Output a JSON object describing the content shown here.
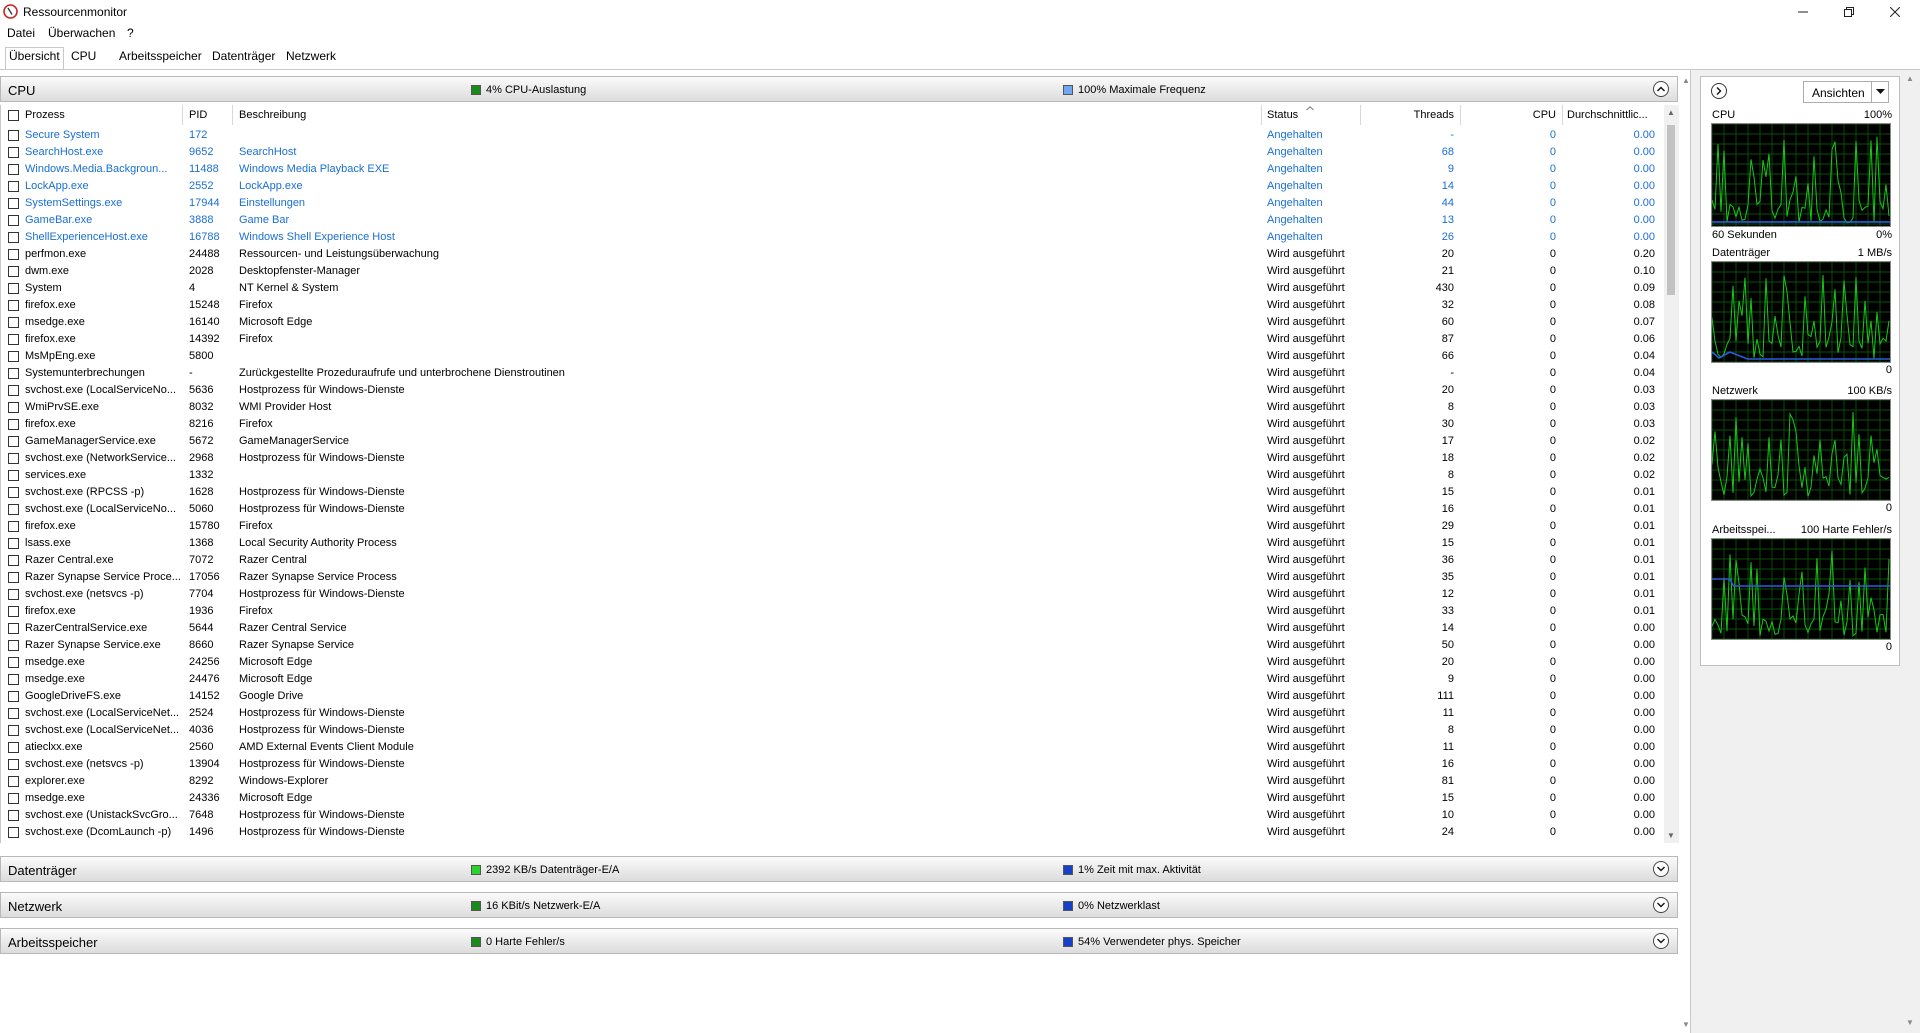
{
  "window": {
    "title": "Ressourcenmonitor"
  },
  "menu": [
    "Datei",
    "Überwachen",
    "?"
  ],
  "tabs": [
    "Übersicht",
    "CPU",
    "Arbeitsspeicher",
    "Datenträger",
    "Netzwerk"
  ],
  "sections": {
    "cpu": {
      "title": "CPU",
      "stat1": "4% CPU-Auslastung",
      "stat2": "100% Maximale Frequenz",
      "color1": "#1b8a1b",
      "color2": "#6fa8f0"
    },
    "disk": {
      "title": "Datenträger",
      "stat1": "2392 KB/s Datenträger-E/A",
      "stat2": "1% Zeit mit max. Aktivität",
      "color1": "#2ad32a",
      "color2": "#1640c8"
    },
    "network": {
      "title": "Netzwerk",
      "stat1": "16 KBit/s Netzwerk-E/A",
      "stat2": "0% Netzwerklast",
      "color1": "#1b8a1b",
      "color2": "#1640c8"
    },
    "memory": {
      "title": "Arbeitsspeicher",
      "stat1": "0 Harte Fehler/s",
      "stat2": "54% Verwendeter phys. Speicher",
      "color1": "#1b8a1b",
      "color2": "#1640c8"
    }
  },
  "columns": {
    "process": "Prozess",
    "pid": "PID",
    "description": "Beschreibung",
    "status": "Status",
    "threads": "Threads",
    "cpu": "CPU",
    "avg": "Durchschnittlic..."
  },
  "rows": [
    [
      "Secure System",
      "172",
      "",
      "Angehalten",
      "-",
      "0",
      "0.00"
    ],
    [
      "SearchHost.exe",
      "9652",
      "SearchHost",
      "Angehalten",
      "68",
      "0",
      "0.00"
    ],
    [
      "Windows.Media.Backgroun...",
      "11488",
      "Windows Media Playback EXE",
      "Angehalten",
      "9",
      "0",
      "0.00"
    ],
    [
      "LockApp.exe",
      "2552",
      "LockApp.exe",
      "Angehalten",
      "14",
      "0",
      "0.00"
    ],
    [
      "SystemSettings.exe",
      "17944",
      "Einstellungen",
      "Angehalten",
      "44",
      "0",
      "0.00"
    ],
    [
      "GameBar.exe",
      "3888",
      "Game Bar",
      "Angehalten",
      "13",
      "0",
      "0.00"
    ],
    [
      "ShellExperienceHost.exe",
      "16788",
      "Windows Shell Experience Host",
      "Angehalten",
      "26",
      "0",
      "0.00"
    ],
    [
      "perfmon.exe",
      "24488",
      "Ressourcen- und Leistungsüberwachung",
      "Wird ausgeführt",
      "20",
      "0",
      "0.20"
    ],
    [
      "dwm.exe",
      "2028",
      "Desktopfenster-Manager",
      "Wird ausgeführt",
      "21",
      "0",
      "0.10"
    ],
    [
      "System",
      "4",
      "NT Kernel & System",
      "Wird ausgeführt",
      "430",
      "0",
      "0.09"
    ],
    [
      "firefox.exe",
      "15248",
      "Firefox",
      "Wird ausgeführt",
      "32",
      "0",
      "0.08"
    ],
    [
      "msedge.exe",
      "16140",
      "Microsoft Edge",
      "Wird ausgeführt",
      "60",
      "0",
      "0.07"
    ],
    [
      "firefox.exe",
      "14392",
      "Firefox",
      "Wird ausgeführt",
      "87",
      "0",
      "0.06"
    ],
    [
      "MsMpEng.exe",
      "5800",
      "",
      "Wird ausgeführt",
      "66",
      "0",
      "0.04"
    ],
    [
      "Systemunterbrechungen",
      "-",
      "Zurückgestellte Prozeduraufrufe und unterbrochene Dienstroutinen",
      "Wird ausgeführt",
      "-",
      "0",
      "0.04"
    ],
    [
      "svchost.exe (LocalServiceNo...",
      "5636",
      "Hostprozess für Windows-Dienste",
      "Wird ausgeführt",
      "20",
      "0",
      "0.03"
    ],
    [
      "WmiPrvSE.exe",
      "8032",
      "WMI Provider Host",
      "Wird ausgeführt",
      "8",
      "0",
      "0.03"
    ],
    [
      "firefox.exe",
      "8216",
      "Firefox",
      "Wird ausgeführt",
      "30",
      "0",
      "0.03"
    ],
    [
      "GameManagerService.exe",
      "5672",
      "GameManagerService",
      "Wird ausgeführt",
      "17",
      "0",
      "0.02"
    ],
    [
      "svchost.exe (NetworkService...",
      "2968",
      "Hostprozess für Windows-Dienste",
      "Wird ausgeführt",
      "18",
      "0",
      "0.02"
    ],
    [
      "services.exe",
      "1332",
      "",
      "Wird ausgeführt",
      "8",
      "0",
      "0.02"
    ],
    [
      "svchost.exe (RPCSS -p)",
      "1628",
      "Hostprozess für Windows-Dienste",
      "Wird ausgeführt",
      "15",
      "0",
      "0.01"
    ],
    [
      "svchost.exe (LocalServiceNo...",
      "5060",
      "Hostprozess für Windows-Dienste",
      "Wird ausgeführt",
      "16",
      "0",
      "0.01"
    ],
    [
      "firefox.exe",
      "15780",
      "Firefox",
      "Wird ausgeführt",
      "29",
      "0",
      "0.01"
    ],
    [
      "lsass.exe",
      "1368",
      "Local Security Authority Process",
      "Wird ausgeführt",
      "15",
      "0",
      "0.01"
    ],
    [
      "Razer Central.exe",
      "7072",
      "Razer Central",
      "Wird ausgeführt",
      "36",
      "0",
      "0.01"
    ],
    [
      "Razer Synapse Service Proce...",
      "17056",
      "Razer Synapse Service Process",
      "Wird ausgeführt",
      "35",
      "0",
      "0.01"
    ],
    [
      "svchost.exe (netsvcs -p)",
      "7704",
      "Hostprozess für Windows-Dienste",
      "Wird ausgeführt",
      "12",
      "0",
      "0.01"
    ],
    [
      "firefox.exe",
      "1936",
      "Firefox",
      "Wird ausgeführt",
      "33",
      "0",
      "0.01"
    ],
    [
      "RazerCentralService.exe",
      "5644",
      "Razer Central Service",
      "Wird ausgeführt",
      "14",
      "0",
      "0.00"
    ],
    [
      "Razer Synapse Service.exe",
      "8660",
      "Razer Synapse Service",
      "Wird ausgeführt",
      "50",
      "0",
      "0.00"
    ],
    [
      "msedge.exe",
      "24256",
      "Microsoft Edge",
      "Wird ausgeführt",
      "20",
      "0",
      "0.00"
    ],
    [
      "msedge.exe",
      "24476",
      "Microsoft Edge",
      "Wird ausgeführt",
      "9",
      "0",
      "0.00"
    ],
    [
      "GoogleDriveFS.exe",
      "14152",
      "Google Drive",
      "Wird ausgeführt",
      "111",
      "0",
      "0.00"
    ],
    [
      "svchost.exe (LocalServiceNet...",
      "2524",
      "Hostprozess für Windows-Dienste",
      "Wird ausgeführt",
      "11",
      "0",
      "0.00"
    ],
    [
      "svchost.exe (LocalServiceNet...",
      "4036",
      "Hostprozess für Windows-Dienste",
      "Wird ausgeführt",
      "8",
      "0",
      "0.00"
    ],
    [
      "atieclxx.exe",
      "2560",
      "AMD External Events Client Module",
      "Wird ausgeführt",
      "11",
      "0",
      "0.00"
    ],
    [
      "svchost.exe (netsvcs -p)",
      "13904",
      "Hostprozess für Windows-Dienste",
      "Wird ausgeführt",
      "16",
      "0",
      "0.00"
    ],
    [
      "explorer.exe",
      "8292",
      "Windows-Explorer",
      "Wird ausgeführt",
      "81",
      "0",
      "0.00"
    ],
    [
      "msedge.exe",
      "24336",
      "Microsoft Edge",
      "Wird ausgeführt",
      "15",
      "0",
      "0.00"
    ],
    [
      "svchost.exe (UnistackSvcGro...",
      "7648",
      "Hostprozess für Windows-Dienste",
      "Wird ausgeführt",
      "10",
      "0",
      "0.00"
    ],
    [
      "svchost.exe (DcomLaunch -p)",
      "1496",
      "Hostprozess für Windows-Dienste",
      "Wird ausgeführt",
      "24",
      "0",
      "0.00"
    ]
  ],
  "right_panel": {
    "views_label": "Ansichten",
    "graphs": [
      {
        "name": "CPU",
        "top_right": "100%",
        "bottom_left": "60 Sekunden",
        "bottom_right": "0%"
      },
      {
        "name": "Datenträger",
        "top_right": "1 MB/s",
        "bottom_left": "",
        "bottom_right": "0"
      },
      {
        "name": "Netzwerk",
        "top_right": "100 KB/s",
        "bottom_left": "",
        "bottom_right": "0"
      },
      {
        "name": "Arbeitsspei...",
        "top_right": "100 Harte Fehler/s",
        "bottom_left": "",
        "bottom_right": "0"
      }
    ]
  },
  "colors": {
    "link_blue": "#1a6fd1",
    "graph_green": "#19c819",
    "graph_blue": "#2a5ce0",
    "graph_bg": "#000000"
  }
}
